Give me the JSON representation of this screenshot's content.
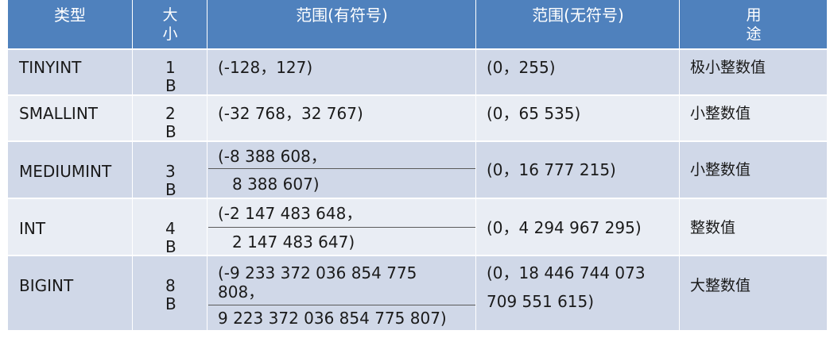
{
  "table": {
    "headers": {
      "type": "类型",
      "size_line1": "大",
      "size_line2": "小",
      "signed": "范围(有符号)",
      "unsigned": "范围(无符号)",
      "use_line1": "用",
      "use_line2": "途"
    },
    "rows": [
      {
        "type": "TINYINT",
        "size_num": "1",
        "size_unit": "B",
        "signed": "(-128，127)",
        "unsigned": "(0，255)",
        "use": "极小整数值"
      },
      {
        "type": "SMALLINT",
        "size_num": "2",
        "size_unit": "B",
        "signed": "(-32 768，32 767)",
        "unsigned": "(0，65 535)",
        "use": "小整数值"
      },
      {
        "type": "MEDIUMINT",
        "size_num": "3",
        "size_unit": "B",
        "signed_line1": "(-8 388 608，",
        "signed_line2": "8 388 607)",
        "unsigned": "(0，16 777 215)",
        "use": "小整数值"
      },
      {
        "type": "INT",
        "size_num": "4",
        "size_unit": "B",
        "signed_line1": "(-2 147 483 648，",
        "signed_line2": "2 147 483 647)",
        "unsigned": "(0，4 294 967 295)",
        "use": "整数值"
      },
      {
        "type": "BIGINT",
        "size_num": "8",
        "size_unit": "B",
        "signed_line1": "(-9 233 372 036 854 775",
        "signed_line1b": "808，",
        "signed_line2": "9 223 372 036 854 775 807)",
        "unsigned_line1": "(0，18 446 744 073",
        "unsigned_line2": "709 551 615)",
        "use": "大整数值"
      }
    ]
  },
  "colors": {
    "header_bg": "#4f81bd",
    "row_odd_bg": "#d0d8e8",
    "row_even_bg": "#e9edf4"
  }
}
